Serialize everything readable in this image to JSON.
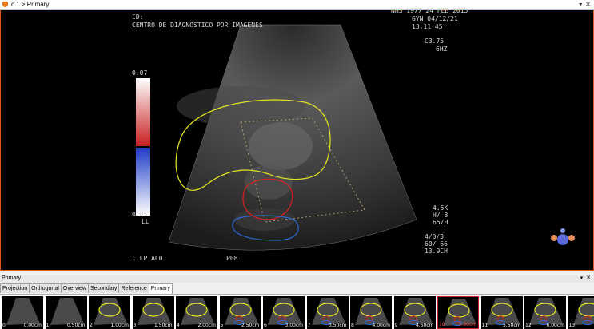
{
  "window": {
    "title": "c 1 > Primary",
    "buttons": [
      "▾",
      "✕"
    ]
  },
  "overlay": {
    "top_left_1": "ID:",
    "top_left_2": "CENTRO DE DIAGNOSTICO POR IMAGENES",
    "top_right_1": "NHS 1977 24 FEB 2015",
    "top_right_2": "GYN 04/12/21",
    "top_right_3": "13:11:45",
    "probe": "C3.75",
    "freq": "6HZ",
    "scale_top": "0.07",
    "scale_bottom": "0.05",
    "scale_unit": "LL",
    "params": "4.5K\nH/ 8\n65/H",
    "gain": "4/0/3\n60/ 66\n13.9CH",
    "bottom_left": "1 LP AC0",
    "bottom_mid": "P08"
  },
  "colors": {
    "frame": "#e05a1a",
    "contour_yellow": "#e6e620",
    "contour_red": "#e02020",
    "contour_blue": "#2a6ad8"
  },
  "panel": {
    "label": "Primary",
    "controls": [
      "▾",
      "✕"
    ]
  },
  "tabs": [
    "Projection",
    "Orthogonal",
    "Overview",
    "Secondary",
    "Reference",
    "Primary"
  ],
  "active_tab": "Primary",
  "thumbnails": [
    {
      "index": "0",
      "distance": "0.00cm"
    },
    {
      "index": "1",
      "distance": "0.50cm"
    },
    {
      "index": "2",
      "distance": "1.00cm"
    },
    {
      "index": "3",
      "distance": "1.50cm"
    },
    {
      "index": "4",
      "distance": "2.00cm"
    },
    {
      "index": "5",
      "distance": "2.50cm"
    },
    {
      "index": "6",
      "distance": "3.00cm"
    },
    {
      "index": "7",
      "distance": "3.50cm"
    },
    {
      "index": "8",
      "distance": "4.00cm"
    },
    {
      "index": "9",
      "distance": "4.50cm"
    },
    {
      "index": "10",
      "distance": "5.00cm"
    },
    {
      "index": "11",
      "distance": "5.50cm"
    },
    {
      "index": "12",
      "distance": "6.00cm"
    },
    {
      "index": "13",
      "distance": "6.5"
    }
  ],
  "selected_thumbnail": "10"
}
